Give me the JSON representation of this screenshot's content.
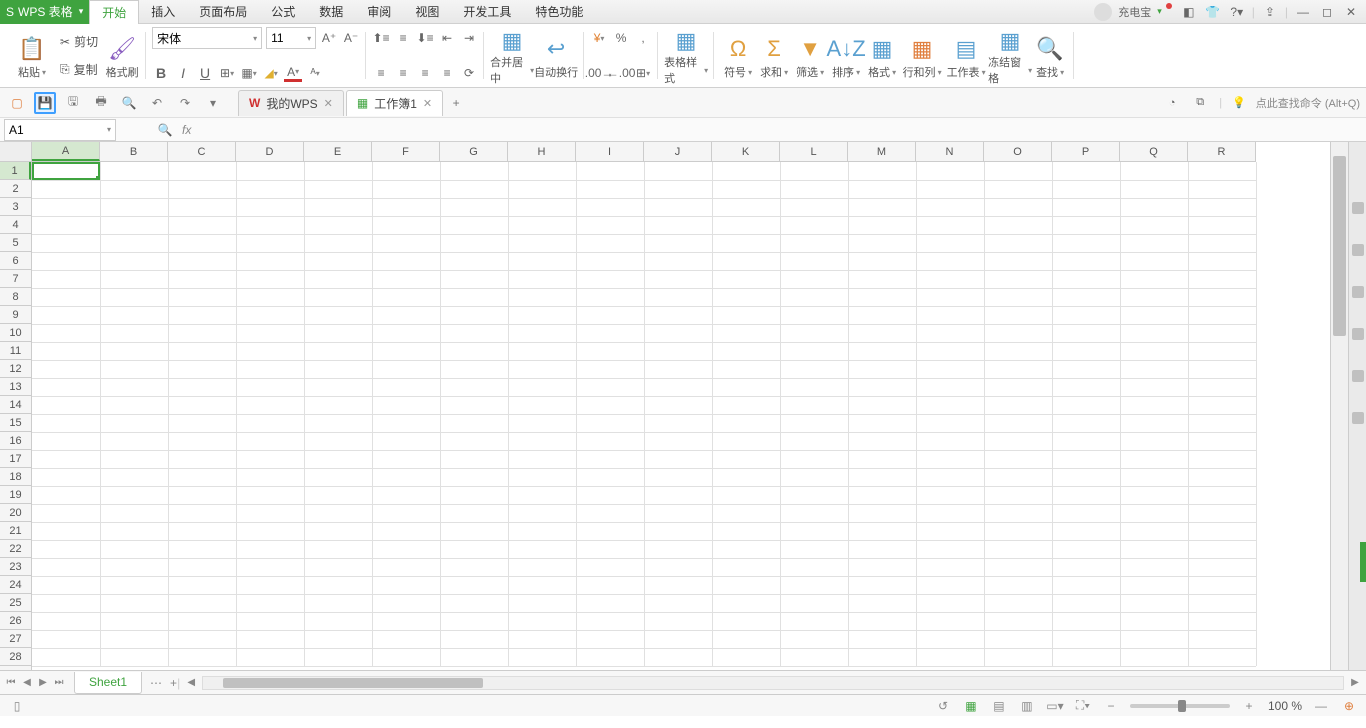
{
  "app": {
    "name": "WPS 表格"
  },
  "menu": [
    "开始",
    "插入",
    "页面布局",
    "公式",
    "数据",
    "审阅",
    "视图",
    "开发工具",
    "特色功能"
  ],
  "user": {
    "name": "充电宝"
  },
  "ribbon": {
    "paste": "粘贴",
    "cut": "剪切",
    "copy": "复制",
    "format_painter": "格式刷",
    "font": "宋体",
    "font_size": "11",
    "merge_center": "合并居中",
    "auto_wrap": "自动换行",
    "table_style": "表格样式",
    "symbol": "符号",
    "sum": "求和",
    "filter": "筛选",
    "sort": "排序",
    "format": "格式",
    "row_col": "行和列",
    "worksheet": "工作表",
    "freeze": "冻结窗格",
    "find": "查找"
  },
  "qat_tip": "点此查找命令 (Alt+Q)",
  "doc_tabs": [
    {
      "label": "我的WPS",
      "icon": "wps"
    },
    {
      "label": "工作簿1",
      "icon": "sheet",
      "active": true
    }
  ],
  "namebox": "A1",
  "columns": [
    "A",
    "B",
    "C",
    "D",
    "E",
    "F",
    "G",
    "H",
    "I",
    "J",
    "K",
    "L",
    "M",
    "N",
    "O",
    "P",
    "Q",
    "R"
  ],
  "row_count": 28,
  "sheet_tab": "Sheet1",
  "zoom": "100 %"
}
